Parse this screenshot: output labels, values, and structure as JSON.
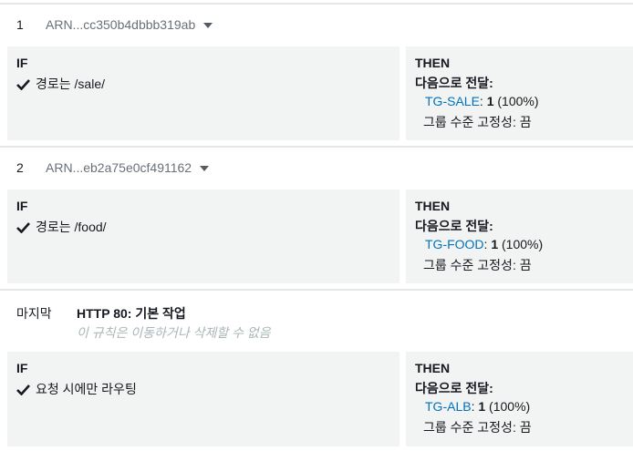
{
  "rules": [
    {
      "number": "1",
      "arn": "ARN...cc350b4dbbb319ab",
      "if_title": "IF",
      "condition": "경로는 /sale/",
      "then_title": "THEN",
      "forward_label": "다음으로 전달:",
      "target_group": "TG-SALE",
      "weight": "1",
      "percent": "(100%)",
      "stickiness": "그룹 수준 고정성: 끔"
    },
    {
      "number": "2",
      "arn": "ARN...eb2a75e0cf491162",
      "if_title": "IF",
      "condition": "경로는 /food/",
      "then_title": "THEN",
      "forward_label": "다음으로 전달:",
      "target_group": "TG-FOOD",
      "weight": "1",
      "percent": "(100%)",
      "stickiness": "그룹 수준 고정성: 끔"
    }
  ],
  "default_rule": {
    "label": "마지막",
    "title": "HTTP 80: 기본 작업",
    "note": "이 규칙은 이동하거나 삭제할 수 없음",
    "if_title": "IF",
    "condition": "요청 시에만 라우팅",
    "then_title": "THEN",
    "forward_label": "다음으로 전달:",
    "target_group": "TG-ALB",
    "weight": "1",
    "percent": "(100%)",
    "stickiness": "그룹 수준 고정성: 끔"
  },
  "icons": {
    "check": "checkmark-icon",
    "dropdown": "caret-down-icon"
  },
  "colors": {
    "link": "#0073bb",
    "panel": "#f2f3f3",
    "muted": "#687078",
    "note": "#aab7b8"
  }
}
